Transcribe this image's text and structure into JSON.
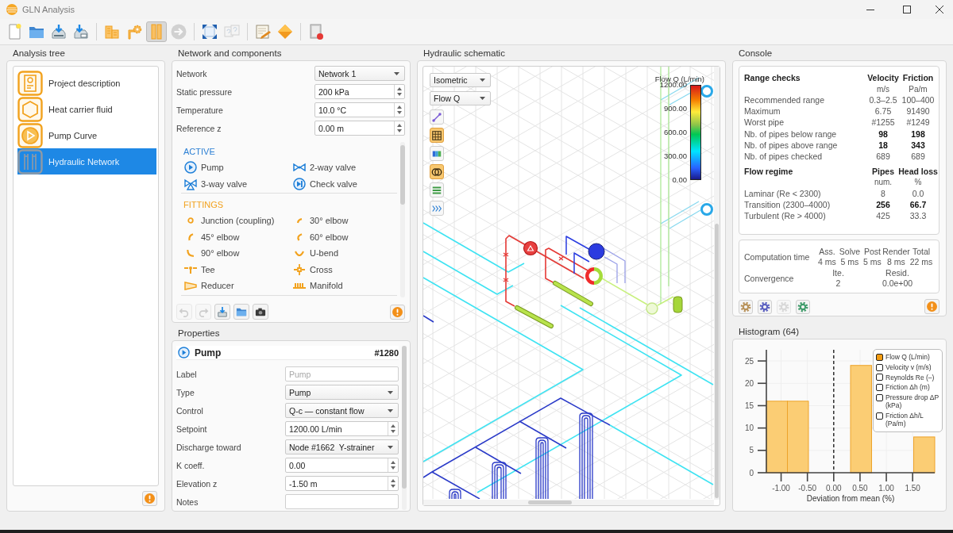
{
  "window": {
    "title": "GLN Analysis"
  },
  "toolbar": {
    "groups": [
      [
        {
          "selected": false,
          "disabled": false
        },
        {
          "selected": false,
          "disabled": false
        },
        {
          "selected": false,
          "disabled": false
        },
        {
          "selected": false,
          "disabled": false
        }
      ],
      [
        {
          "selected": false,
          "disabled": false
        },
        {
          "selected": false,
          "disabled": false
        },
        {
          "selected": true,
          "disabled": false
        },
        {
          "selected": false,
          "disabled": true
        }
      ],
      [
        {
          "selected": false,
          "disabled": false
        },
        {
          "selected": false,
          "disabled": true
        }
      ],
      [
        {
          "selected": false,
          "disabled": false
        },
        {
          "selected": false,
          "disabled": false
        }
      ],
      [
        {
          "selected": false,
          "disabled": false
        }
      ]
    ]
  },
  "analysis_tree": {
    "title": "Analysis tree",
    "items": [
      {
        "label": "Project description",
        "selected": false
      },
      {
        "label": "Heat carrier fluid",
        "selected": false
      },
      {
        "label": "Pump Curve",
        "selected": false
      },
      {
        "label": "Hydraulic Network",
        "selected": true
      }
    ]
  },
  "network": {
    "title": "Network and components",
    "fields": [
      {
        "label": "Network",
        "kind": "select",
        "value": "Network 1"
      },
      {
        "label": "Static pressure",
        "kind": "spin",
        "value": "200 kPa"
      },
      {
        "label": "Temperature",
        "kind": "spin",
        "value": "10.0 °C"
      },
      {
        "label": "Reference z",
        "kind": "spin",
        "value": "0.00 m"
      }
    ],
    "sections": [
      {
        "title": "ACTIVE",
        "kind": "active",
        "items": [
          "Pump",
          "2-way valve",
          "3-way valve",
          "Check valve"
        ]
      },
      {
        "title": "FITTINGS",
        "kind": "fittings",
        "items": [
          "Junction (coupling)",
          "30° elbow",
          "45° elbow",
          "60° elbow",
          "90° elbow",
          "U-bend",
          "Tee",
          "Cross",
          "Reducer",
          "Manifold"
        ]
      }
    ],
    "actions": [
      {
        "disabled": true
      },
      {
        "disabled": true
      },
      {
        "disabled": false
      },
      {
        "disabled": false
      },
      {
        "disabled": false
      }
    ]
  },
  "properties": {
    "title": "Properties",
    "header": {
      "name": "Pump",
      "id": "#1280"
    },
    "fields": [
      {
        "label": "Label",
        "kind": "text",
        "placeholder": "Pump"
      },
      {
        "label": "Type",
        "kind": "select",
        "value": "Pump"
      },
      {
        "label": "Control",
        "kind": "select",
        "value": "Q-c — constant flow"
      },
      {
        "label": "Setpoint",
        "kind": "spin",
        "value": "1200.00 L/min"
      },
      {
        "label": "Discharge toward",
        "kind": "select",
        "value": "Node #1662  Y-strainer"
      },
      {
        "label": "K coeff.",
        "kind": "spin",
        "value": "0.00"
      },
      {
        "label": "Elevation z",
        "kind": "spin",
        "value": "-1.50 m"
      },
      {
        "label": "Notes",
        "kind": "text"
      }
    ]
  },
  "schematic": {
    "title": "Hydraulic schematic",
    "view": "Isometric",
    "quantity": "Flow Q",
    "tools": [
      {
        "selected": false
      },
      {
        "selected": true
      },
      {
        "selected": false
      },
      {
        "selected": true
      },
      {
        "selected": false
      },
      {
        "selected": false
      }
    ],
    "color_scale": {
      "title": "Flow Q (L/min)",
      "ticks": [
        "1200.00",
        "900.00",
        "600.00",
        "300.00",
        "0.00"
      ]
    }
  },
  "console": {
    "title": "Console",
    "range_checks": {
      "title": "Range checks",
      "columns": [
        {
          "name": "Velocity",
          "unit": "m/s"
        },
        {
          "name": "Friction",
          "unit": "Pa/m"
        }
      ],
      "rows": [
        {
          "label": "Recommended range",
          "values": [
            "0.3–2.5",
            "100–400"
          ],
          "emphasized": false
        },
        {
          "label": "Maximum",
          "values": [
            "6.75",
            "91490"
          ],
          "emphasized": false
        },
        {
          "label": "Worst pipe",
          "values": [
            "#1255",
            "#1249"
          ],
          "emphasized": false
        },
        {
          "label": "Nb. of pipes below range",
          "values": [
            "98",
            "198"
          ],
          "emphasized": true
        },
        {
          "label": "Nb. of pipes above range",
          "values": [
            "18",
            "343"
          ],
          "emphasized": true
        },
        {
          "label": "Nb. of pipes checked",
          "values": [
            "689",
            "689"
          ],
          "emphasized": false
        }
      ]
    },
    "flow_regime": {
      "title": "Flow regime",
      "columns": [
        {
          "name": "Pipes",
          "unit": "num."
        },
        {
          "name": "Head loss",
          "unit": "%"
        }
      ],
      "rows": [
        {
          "label": "Laminar (Re < 2300)",
          "values": [
            "8",
            "0.0"
          ],
          "emphasized": false
        },
        {
          "label": "Transition (2300–4000)",
          "values": [
            "256",
            "66.7"
          ],
          "emphasized": true
        },
        {
          "label": "Turbulent (Re > 4000)",
          "values": [
            "425",
            "33.3"
          ],
          "emphasized": false
        }
      ]
    },
    "timing": {
      "label": "Computation time",
      "columns": [
        {
          "name": "Ass.",
          "value": "4 ms"
        },
        {
          "name": "Solve",
          "value": "5 ms"
        },
        {
          "name": "Post",
          "value": "5 ms"
        },
        {
          "name": "Render",
          "value": "8 ms"
        },
        {
          "name": "Total",
          "value": "22 ms"
        }
      ]
    },
    "convergence": {
      "label": "Convergence",
      "columns": [
        {
          "name": "Ite.",
          "value": "2"
        },
        {
          "name": "Resid.",
          "value": "0.0e+00"
        }
      ]
    },
    "tools": [
      {
        "disabled": false
      },
      {
        "disabled": false
      },
      {
        "disabled": true
      },
      {
        "disabled": false
      }
    ]
  },
  "histogram": {
    "title": "Histogram (64)",
    "legend": [
      {
        "label": "Flow Q (L/min)",
        "checked": true
      },
      {
        "label": "Velocity v (m/s)",
        "checked": false
      },
      {
        "label": "Reynolds Re (–)",
        "checked": false
      },
      {
        "label": "Friction Δh (m)",
        "checked": false
      },
      {
        "label": "Pressure drop ΔP (kPa)",
        "checked": false
      },
      {
        "label": "Friction Δh/L (Pa/m)",
        "checked": false
      }
    ],
    "chart_data": {
      "type": "bar",
      "xlabel": "Deviation from mean (%)",
      "x": [
        -1.08,
        -0.68,
        0.52,
        1.72
      ],
      "values": [
        16,
        16,
        24,
        8
      ],
      "xlim": [
        -1.28,
        1.92
      ],
      "ylim": [
        0,
        27.5
      ],
      "xticks": [
        {
          "value": -1,
          "label": "-1.00"
        },
        {
          "value": -0.5,
          "label": "-0.50"
        },
        {
          "value": 0,
          "label": "0.00"
        },
        {
          "value": 0.5,
          "label": "0.50"
        },
        {
          "value": 1,
          "label": "1.00"
        },
        {
          "value": 1.5,
          "label": "1.50"
        }
      ],
      "yticks": [
        0,
        5,
        10,
        15,
        20,
        25
      ],
      "grid": true,
      "ref_lines": [
        {
          "axis": "x",
          "value": 0
        }
      ]
    }
  }
}
